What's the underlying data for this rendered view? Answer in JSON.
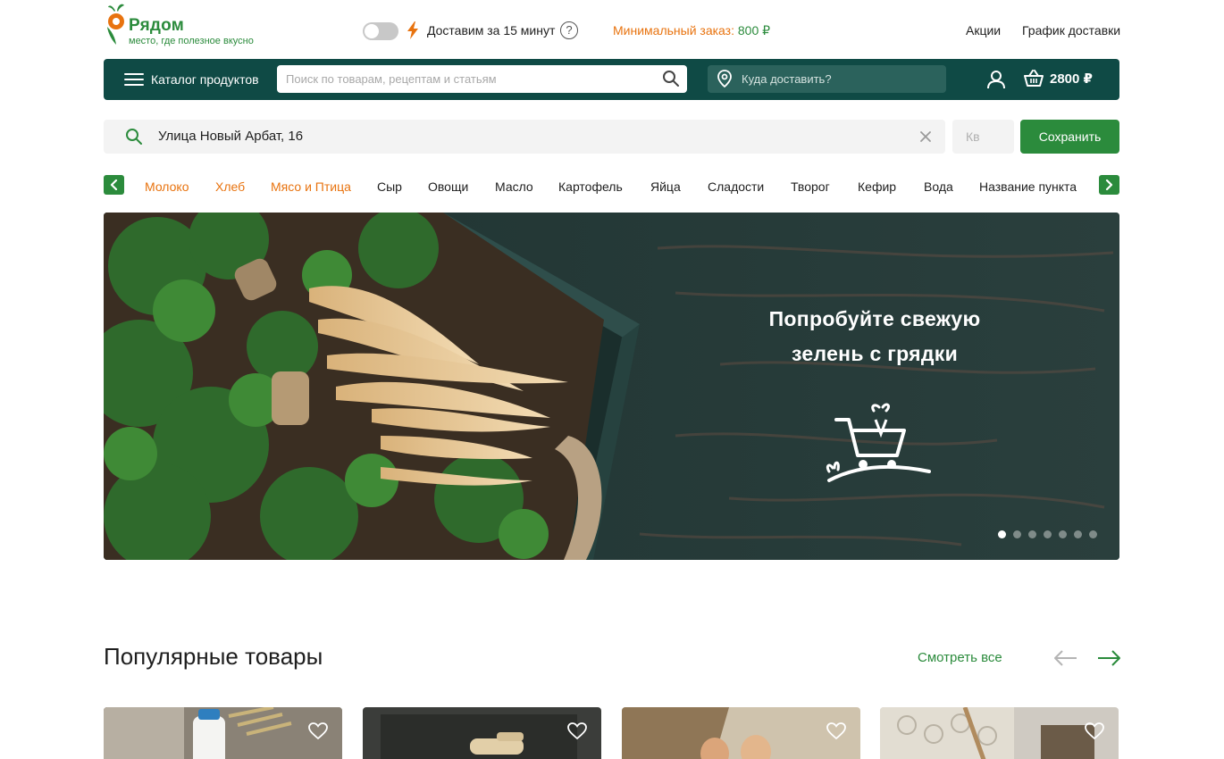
{
  "brand": {
    "name": "Рядом",
    "tagline": "место, где полезное вкусно",
    "primary_color": "#2b8b3c",
    "accent_color": "#e8730f",
    "nav_color": "#0f4a45"
  },
  "topbar": {
    "express_toggle_on": false,
    "delivery_text": "Доставим за 15 минут",
    "help_glyph": "?",
    "min_order_label": "Минимальный заказ:",
    "min_order_amount": "800 ₽",
    "links": [
      "Акции",
      "График доставки"
    ]
  },
  "navbar": {
    "catalog_label": "Каталог продуктов",
    "search_placeholder": "Поиск по товарам, рецептам и статьям",
    "address_label": "Куда доставить?",
    "basket_total": "2800 ₽",
    "icons": [
      "menu-icon",
      "search-icon",
      "location-pin-icon",
      "user-icon",
      "basket-icon"
    ]
  },
  "address_form": {
    "street_value": "Улица Новый Арбат, 16",
    "apartment_placeholder": "Кв",
    "save_label": "Сохранить"
  },
  "categories": [
    {
      "label": "Молоко",
      "highlighted": true
    },
    {
      "label": "Хлеб",
      "highlighted": true
    },
    {
      "label": "Мясо и Птица",
      "highlighted": true
    },
    {
      "label": "Сыр",
      "highlighted": false
    },
    {
      "label": "Овощи",
      "highlighted": false
    },
    {
      "label": "Масло",
      "highlighted": false
    },
    {
      "label": "Картофель",
      "highlighted": false
    },
    {
      "label": "Яйца",
      "highlighted": false
    },
    {
      "label": "Сладости",
      "highlighted": false
    },
    {
      "label": "Творог",
      "highlighted": false
    },
    {
      "label": "Кефир",
      "highlighted": false
    },
    {
      "label": "Вода",
      "highlighted": false
    },
    {
      "label": "Название пункта",
      "highlighted": false
    }
  ],
  "banner": {
    "title_line1": "Попробуйте свежую",
    "title_line2": "зелень с грядки",
    "slide_count": 7,
    "active_slide": 1
  },
  "popular": {
    "title": "Популярные товары",
    "see_all_label": "Смотреть все",
    "cards": [
      {
        "image": "milk-bottle-with-wheat"
      },
      {
        "image": "wooden-scoop-on-dark-board"
      },
      {
        "image": "eggs-on-burlap"
      },
      {
        "image": "lace-napkin-with-spoon"
      }
    ]
  }
}
